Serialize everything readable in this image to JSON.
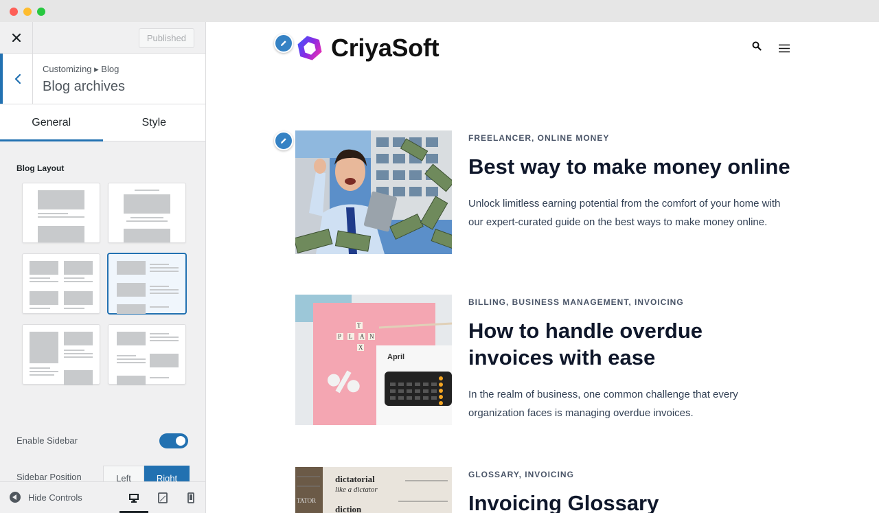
{
  "window": {
    "controls": [
      "close",
      "minimize",
      "zoom"
    ]
  },
  "panel": {
    "close_icon": "close-icon",
    "published_label": "Published",
    "breadcrumb": "Customizing ▸ Blog",
    "section_title": "Blog archives",
    "tabs": [
      {
        "label": "General",
        "active": true
      },
      {
        "label": "Style",
        "active": false
      }
    ],
    "blog_layout_label": "Blog Layout",
    "layouts_selected_index": 3,
    "enable_sidebar_label": "Enable Sidebar",
    "enable_sidebar_on": true,
    "sidebar_position_label": "Sidebar Position",
    "sidebar_position_options": [
      "Left",
      "Right"
    ],
    "sidebar_position_selected": "Right",
    "hide_controls_label": "Hide Controls",
    "devices": [
      "desktop-icon",
      "tablet-icon",
      "mobile-icon"
    ],
    "accent_color": "#2271b1"
  },
  "site": {
    "logo_text": "CriyaSoft",
    "header_icons": [
      "search-icon",
      "menu-icon"
    ]
  },
  "posts": [
    {
      "categories": "FREELANCER, ONLINE MONEY",
      "title": "Best way to make money online",
      "excerpt": "Unlock limitless earning potential from the comfort of your home with our expert-curated guide on the best ways to make money online.",
      "image": "man-with-money-photo"
    },
    {
      "categories": "BILLING, BUSINESS MANAGEMENT, INVOICING",
      "title": "How to handle overdue invoices with ease",
      "excerpt": "In the realm of business, one common challenge that every organization faces is managing overdue invoices.",
      "image": "calculator-calendar-photo",
      "image_texts": [
        "April",
        "T",
        "P",
        "L",
        "A",
        "N",
        "X"
      ]
    },
    {
      "categories": "GLOSSARY, INVOICING",
      "title": "Invoicing Glossary",
      "excerpt": "",
      "image": "dictionary-photo",
      "image_texts": [
        "dictatorial",
        "like a dictator",
        "diction",
        "TATOR"
      ]
    }
  ]
}
